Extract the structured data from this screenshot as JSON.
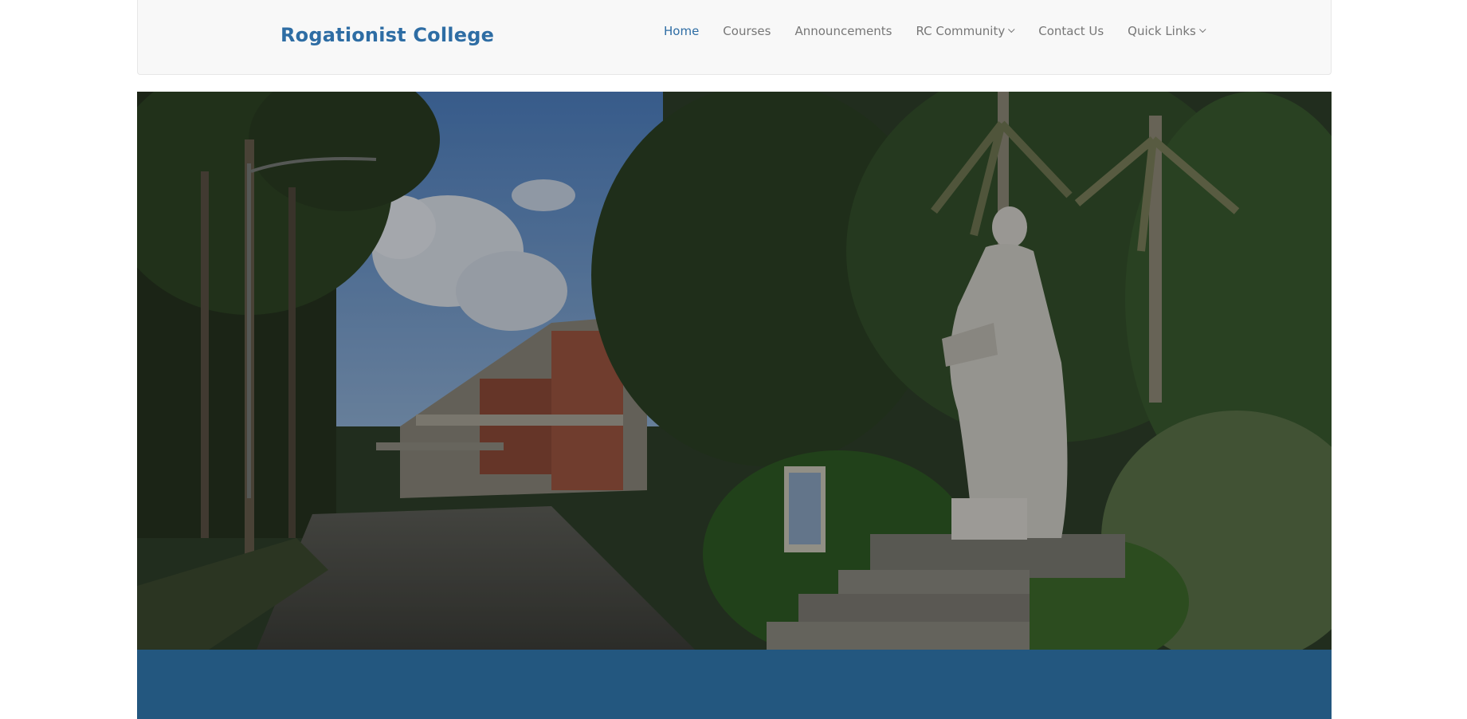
{
  "header": {
    "brand": "Rogationist College"
  },
  "nav": {
    "items": [
      {
        "label": "Home",
        "active": true,
        "dropdown": false
      },
      {
        "label": "Courses",
        "active": false,
        "dropdown": false
      },
      {
        "label": "Announcements",
        "active": false,
        "dropdown": false
      },
      {
        "label": "RC Community",
        "active": false,
        "dropdown": true
      },
      {
        "label": "Contact Us",
        "active": false,
        "dropdown": false
      },
      {
        "label": "Quick Links",
        "active": false,
        "dropdown": true
      }
    ]
  },
  "hero": {
    "image": "campus-photo-with-statue"
  },
  "colors": {
    "brand": "#2e6da4",
    "nav_text": "#777777",
    "navbar_bg": "#f8f8f8",
    "band": "#23577f"
  }
}
